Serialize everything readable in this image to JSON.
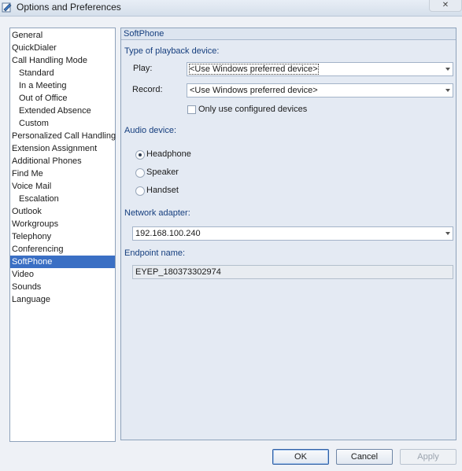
{
  "window": {
    "title": "Options and Preferences",
    "close_label": "✕"
  },
  "nav": {
    "items": [
      {
        "label": "General"
      },
      {
        "label": "QuickDialer"
      },
      {
        "label": "Call Handling Mode"
      },
      {
        "label": "Standard"
      },
      {
        "label": "In a Meeting"
      },
      {
        "label": "Out of Office"
      },
      {
        "label": "Extended Absence"
      },
      {
        "label": "Custom"
      },
      {
        "label": "Personalized Call Handling"
      },
      {
        "label": "Extension Assignment"
      },
      {
        "label": "Additional Phones"
      },
      {
        "label": "Find Me"
      },
      {
        "label": "Voice Mail"
      },
      {
        "label": "Escalation"
      },
      {
        "label": "Outlook"
      },
      {
        "label": "Workgroups"
      },
      {
        "label": "Telephony"
      },
      {
        "label": "Conferencing"
      },
      {
        "label": "SoftPhone"
      },
      {
        "label": "Video"
      },
      {
        "label": "Sounds"
      },
      {
        "label": "Language"
      }
    ],
    "selected": "SoftPhone"
  },
  "panel": {
    "header": "SoftPhone",
    "playback": {
      "section_label": "Type of playback device:",
      "play_label": "Play:",
      "play_value": "<Use Windows preferred device>",
      "record_label": "Record:",
      "record_value": "<Use Windows preferred device>",
      "only_configured_label": "Only use configured devices",
      "only_configured_checked": false
    },
    "audio": {
      "section_label": "Audio device:",
      "options": [
        {
          "label": "Headphone",
          "checked": true
        },
        {
          "label": "Speaker",
          "checked": false
        },
        {
          "label": "Handset",
          "checked": false
        }
      ]
    },
    "network": {
      "section_label": "Network adapter:",
      "value": "192.168.100.240"
    },
    "endpoint": {
      "section_label": "Endpoint name:",
      "value": "EYEP_180373302974"
    }
  },
  "buttons": {
    "ok": "OK",
    "cancel": "Cancel",
    "apply": "Apply"
  }
}
